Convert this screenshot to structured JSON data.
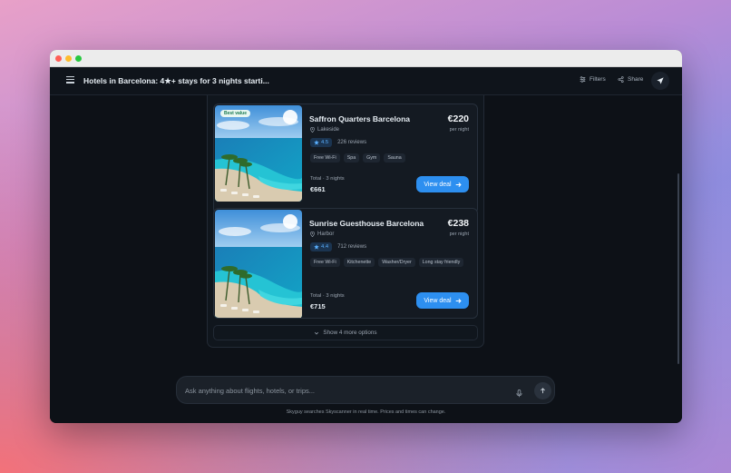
{
  "header": {
    "title": "Hotels in Barcelona: 4★+ stays for 3 nights starti...",
    "filters_label": "Filters",
    "share_label": "Share"
  },
  "icons": {
    "menu": "hamburger-menu-icon",
    "filters": "filters-icon",
    "share": "share-icon",
    "send": "paper-plane-icon",
    "location": "map-pin-icon",
    "star": "star-icon",
    "arrow": "arrow-right-icon",
    "chevron": "chevron-down-icon",
    "mic": "microphone-icon",
    "up": "arrow-up-icon"
  },
  "hotels": [
    {
      "badge": "Best value",
      "name": "Saffron Quarters Barcelona",
      "location": "Lakeside",
      "rating": "4.5",
      "reviews": "226 reviews",
      "amenities": [
        "Free Wi-Fi",
        "Spa",
        "Gym",
        "Sauna"
      ],
      "price": "€220",
      "per_night": "per night",
      "total_label": "Total · 3 nights",
      "total_value": "€661",
      "cta": "View deal"
    },
    {
      "badge": "",
      "name": "Sunrise Guesthouse Barcelona",
      "location": "Harbor",
      "rating": "4.4",
      "reviews": "712 reviews",
      "amenities": [
        "Free Wi-Fi",
        "Kitchenette",
        "Washer/Dryer",
        "Long stay friendly"
      ],
      "price": "€238",
      "per_night": "per night",
      "total_label": "Total · 3 nights",
      "total_value": "€715",
      "cta": "View deal"
    }
  ],
  "show_more_label": "Show 4 more options",
  "composer": {
    "placeholder": "Ask anything about flights, hotels, or trips..."
  },
  "footer_note": "Skyguy searches Skyscanner in real time. Prices and times can change.",
  "colors": {
    "accent": "#2d8ff0",
    "background": "#0d1117",
    "card": "#141a22",
    "rating_text": "#5ab0ff"
  }
}
